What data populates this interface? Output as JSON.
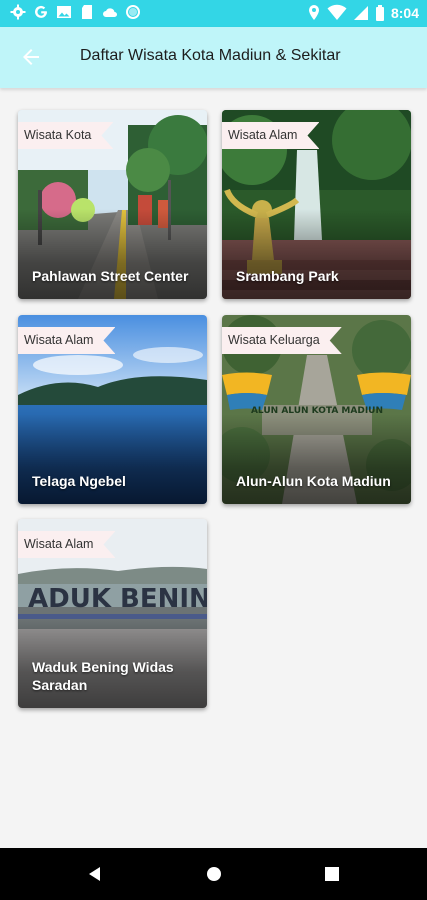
{
  "status_bar": {
    "time": "8:04",
    "left_icons": [
      "gear-icon",
      "google-icon",
      "image-icon",
      "sd-card-icon",
      "cloud-icon",
      "circle-icon"
    ],
    "right_icons": [
      "location-icon",
      "wifi-icon",
      "signal-icon",
      "battery-icon"
    ]
  },
  "app_bar": {
    "title": "Daftar Wisata Kota Madiun & Sekitar",
    "back_icon": "arrow-back-icon"
  },
  "places": [
    {
      "tag": "Wisata Kota",
      "name": "Pahlawan Street Center"
    },
    {
      "tag": "Wisata Alam",
      "name": "Srambang Park"
    },
    {
      "tag": "Wisata Alam",
      "name": "Telaga Ngebel"
    },
    {
      "tag": "Wisata Keluarga",
      "name": "Alun-Alun Kota Madiun"
    },
    {
      "tag": "Wisata Alam",
      "name": "Waduk Bening Widas Saradan"
    }
  ],
  "photo_text": {
    "alun_alun_sign": "ALUN ALUN KOTA MADIUN",
    "waduk_sign": "ADUK BENING"
  },
  "nav_bar": {
    "buttons": [
      "back-triangle-icon",
      "home-circle-icon",
      "recents-square-icon"
    ]
  },
  "colors": {
    "status_bar": "#33d6e6",
    "app_bar": "#bff5f9",
    "tag_bg": "#fbeff0",
    "page_bg": "#f4f4f4"
  }
}
